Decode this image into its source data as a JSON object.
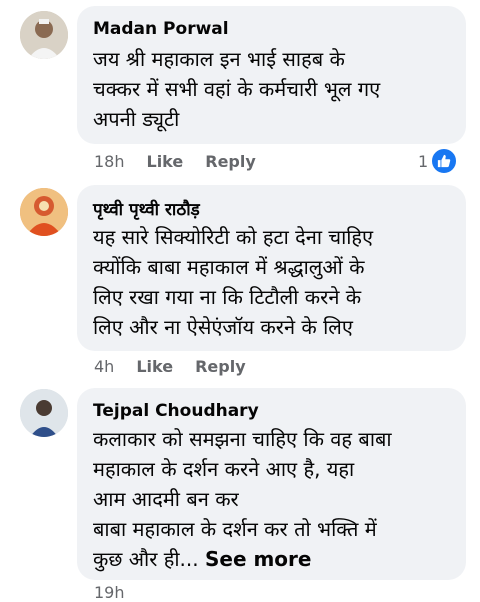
{
  "comments": [
    {
      "author": "Madan Porwal",
      "lines": [
        "जय श्री महाकाल इन भाई साहब के",
        "चक्कर में सभी वहां के कर्मचारी भूल गए",
        "अपनी ड्यूटी"
      ],
      "time": "18h",
      "like_label": "Like",
      "reply_label": "Reply",
      "reaction_count": "1"
    },
    {
      "author": "पृथ्वी पृथ्वी राठौड़",
      "lines": [
        "यह सारे सिक्योरिटी को हटा देना चाहिए",
        "क्योंकि बाबा महाकाल में श्रद्धालुओं के",
        "लिए रखा गया ना कि टिटौली करने के",
        "लिए और ना ऐसेएंजॉय करने के लिए"
      ],
      "time": "4h",
      "like_label": "Like",
      "reply_label": "Reply"
    },
    {
      "author": "Tejpal Choudhary",
      "lines": [
        "कलाकार को समझना चाहिए कि वह बाबा",
        "महाकाल के दर्शन करने आए है, यहा",
        "आम आदमी बन कर",
        "बाबा महाकाल के दर्शन कर तो भक्ति में",
        "कुछ और ही..."
      ],
      "see_more_label": "See more",
      "time": "19h"
    }
  ],
  "colors": {
    "bubble": "#f0f2f5",
    "meta": "#65676b",
    "like_blue": "#1877f2"
  },
  "icons": {
    "reaction": "thumbs-up-icon"
  }
}
